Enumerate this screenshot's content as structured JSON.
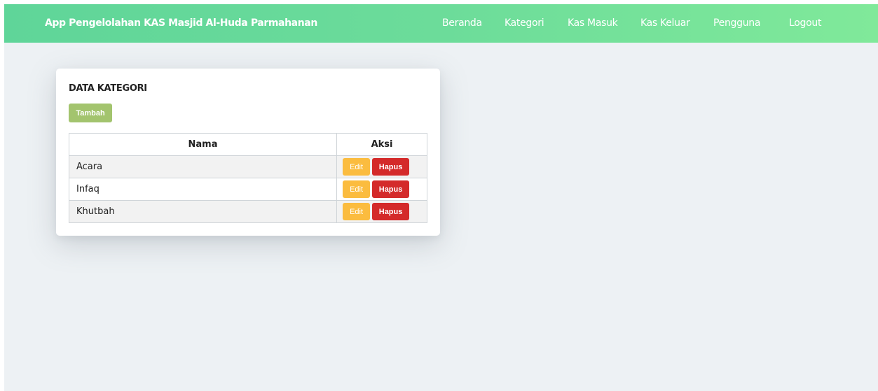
{
  "navbar": {
    "brand": "App Pengelolahan KAS Masjid Al-Huda Parmahanan",
    "links": [
      "Beranda",
      "Kategori",
      "Kas Masuk",
      "Kas Keluar",
      "Pengguna",
      "Logout"
    ]
  },
  "card": {
    "title": "DATA KATEGORI",
    "add_label": "Tambah",
    "table": {
      "headers": [
        "Nama",
        "Aksi"
      ],
      "rows": [
        {
          "nama": "Acara",
          "edit": "Edit",
          "hapus": "Hapus"
        },
        {
          "nama": "Infaq",
          "edit": "Edit",
          "hapus": "Hapus"
        },
        {
          "nama": "Khutbah",
          "edit": "Edit",
          "hapus": "Hapus"
        }
      ]
    }
  },
  "colors": {
    "navbar_start": "#5fd599",
    "navbar_end": "#80e99a",
    "background": "#edf1f4",
    "tambah": "#a3c46e",
    "edit": "#fbbc3f",
    "hapus": "#d42a2a"
  }
}
